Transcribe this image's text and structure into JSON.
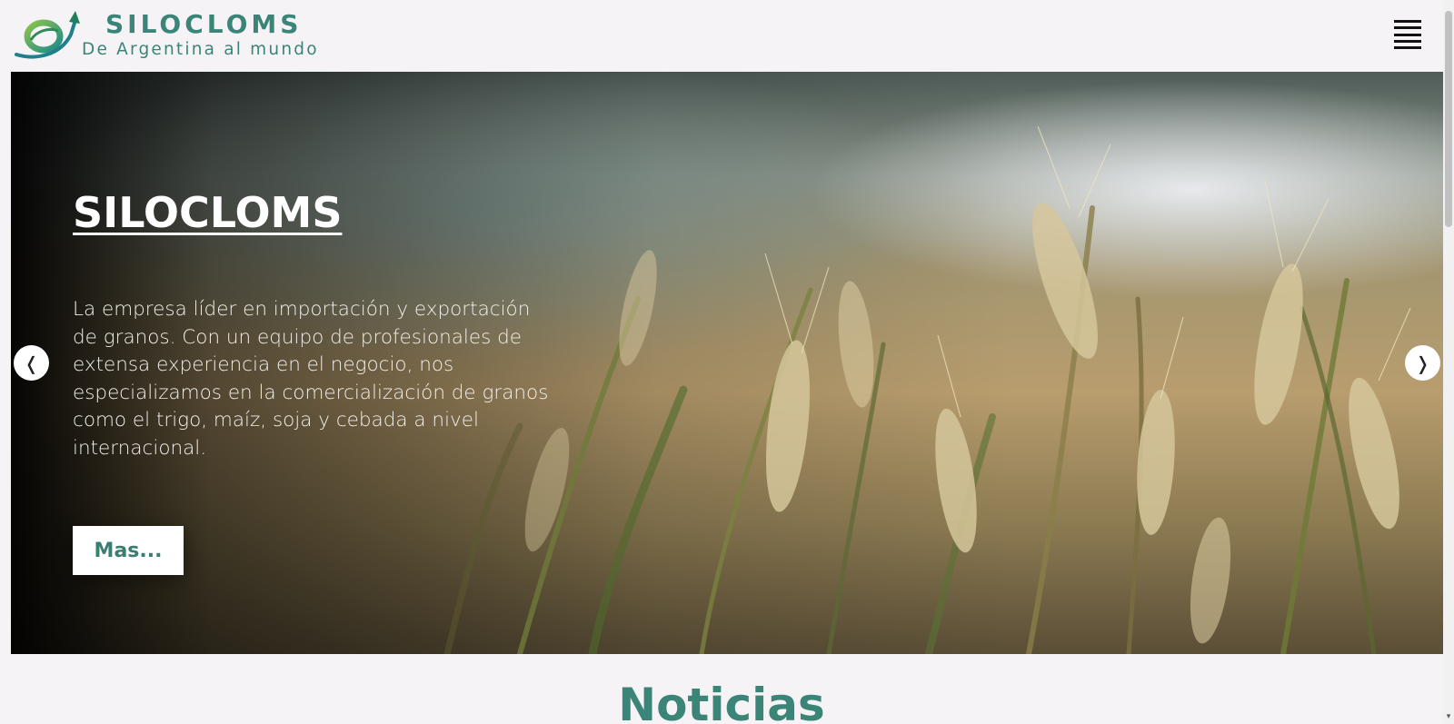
{
  "header": {
    "brand_name": "SILOCLOMS",
    "tagline": "De Argentina al mundo",
    "menu_icon": "hamburger-menu-icon"
  },
  "hero": {
    "title": "SILOCLOMS",
    "description": "La empresa líder en importación y exportación de granos. Con un equipo de profesionales de extensa experiencia en el negocio, nos especializamos en la comercialización de granos como el trigo, maíz, soja y cebada a nivel internacional.",
    "button_label": "Mas...",
    "prev_arrow": "❬",
    "next_arrow": "❭"
  },
  "news": {
    "title": "Noticias"
  },
  "colors": {
    "brand": "#3a8578",
    "background": "#f6f3f7",
    "button_text": "#3a7d71"
  }
}
